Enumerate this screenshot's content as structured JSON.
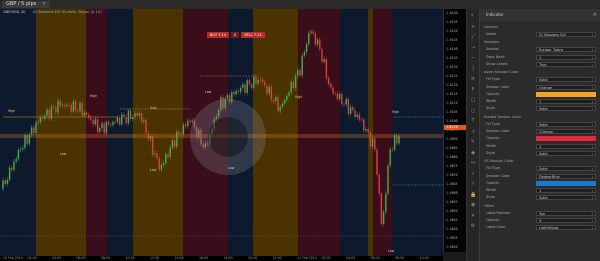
{
  "tab": {
    "title": "GBP / 5 pips",
    "close": "×"
  },
  "chart": {
    "instrument_label": "GBP/USD (5)",
    "indicator_label": "IQ Sessions Ext (Europe, Tokyo) (X 10)",
    "buttons": [
      "BUY 7.14",
      "0",
      "SELL 7.13"
    ],
    "price_scale": [
      "1.6160",
      "1.6155",
      "1.6150",
      "1.6145",
      "1.6140",
      "1.6135",
      "1.6130",
      "1.6125",
      "1.6120",
      "1.6115",
      "1.6110",
      "1.6105",
      "1.6100",
      "1.6095",
      "1.6090",
      "1.6085",
      "1.6080",
      "1.6075",
      "1.6070",
      "1.6065",
      "1.6060",
      "1.6055",
      "1.6050",
      "1.6045",
      "1.6040",
      "1.6035",
      "1.6030"
    ],
    "time_axis": [
      "10 Feb 2014",
      "02:00",
      "04:00",
      "06:00",
      "08:00",
      "10:00",
      "12:00",
      "14:00",
      "16:00",
      "18:00",
      "20:00",
      "22:00",
      "11 Feb 2014",
      "02:00",
      "04:00",
      "06:00",
      "08:00",
      "10:00"
    ],
    "current_price": "1.6125",
    "level_labels": [
      "High",
      "Low",
      "High",
      "Low",
      "High",
      "Low",
      "High",
      "Low",
      "High",
      "Low"
    ]
  },
  "toolbar": {
    "icons": [
      "cursor-icon",
      "crosshair-icon",
      "line-icon",
      "ray-icon",
      "hline-icon",
      "vline-icon",
      "channel-icon",
      "fib-icon",
      "rect-icon",
      "ellipse-icon",
      "text-icon",
      "arrow-icon",
      "brush-icon",
      "marker-icon",
      "measure-icon",
      "zoom-icon",
      "magnet-icon",
      "lock-icon",
      "eye-icon",
      "trash-icon",
      "settings-icon"
    ]
  },
  "panel": {
    "title": "Indicator",
    "close": "×",
    "sections": [
      {
        "title": "General",
        "rows": [
          {
            "label": "Name",
            "value": "IQ Sessions Ext"
          }
        ]
      },
      {
        "title": "Sessions",
        "rows": [
          {
            "label": "Session",
            "value": "Europe_Tokyo"
          },
          {
            "label": "Days Back",
            "value": "1"
          },
          {
            "label": "Show Labels",
            "value": "True"
          }
        ]
      },
      {
        "title": "Asian Session Color",
        "rows": [
          {
            "label": "Fill Type",
            "value": "Solid"
          },
          {
            "label": "Session Color",
            "value": "Orange"
          },
          {
            "label": "Opacity",
            "value": ""
          },
          {
            "label": "Width",
            "value": "1"
          },
          {
            "label": "Style",
            "value": "Solid"
          }
        ]
      },
      {
        "title": "Europe Session Color",
        "rows": [
          {
            "label": "Fill Type",
            "value": "Solid"
          },
          {
            "label": "Session Color",
            "value": "Crimson"
          },
          {
            "label": "Opacity",
            "value": ""
          },
          {
            "label": "Width",
            "value": "1"
          },
          {
            "label": "Style",
            "value": "Solid"
          }
        ]
      },
      {
        "title": "US Session Color",
        "rows": [
          {
            "label": "Fill Type",
            "value": "Solid"
          },
          {
            "label": "Session Color",
            "value": "DodgerBlue"
          },
          {
            "label": "Opacity",
            "value": ""
          },
          {
            "label": "Width",
            "value": "1"
          },
          {
            "label": "Style",
            "value": "Solid"
          }
        ]
      },
      {
        "title": "Other",
        "rows": [
          {
            "label": "Label Position",
            "value": "Top"
          },
          {
            "label": "Opacity",
            "value": "3"
          },
          {
            "label": "Label Color",
            "value": "LightYellow"
          }
        ]
      }
    ],
    "colors": {
      "asian": "#f2a422",
      "europe": "#e0273f",
      "us": "#1a79c9",
      "label": "#f7f0b0"
    }
  },
  "colors": {
    "asian_band": "#4a3300",
    "europe_band": "#3a0d1a",
    "us_band": "#0d1a2e",
    "candle_up": "#3fb24f",
    "candle_down": "#e04040",
    "orange_line": "#ff8a2a"
  }
}
